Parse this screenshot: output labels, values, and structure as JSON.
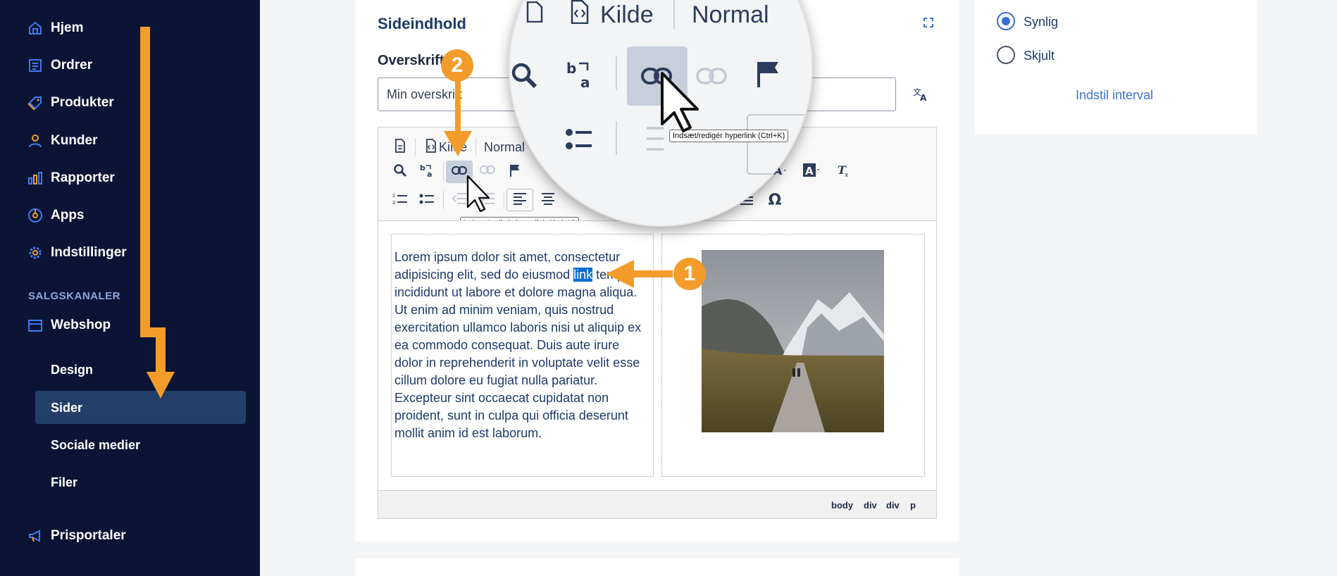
{
  "sidebar": {
    "items": [
      {
        "label": "Hjem",
        "icon": "home-icon"
      },
      {
        "label": "Ordrer",
        "icon": "orders-icon"
      },
      {
        "label": "Produkter",
        "icon": "tag-icon"
      },
      {
        "label": "Kunder",
        "icon": "user-icon"
      },
      {
        "label": "Rapporter",
        "icon": "bar-chart-icon"
      },
      {
        "label": "Apps",
        "icon": "apps-icon"
      },
      {
        "label": "Indstillinger",
        "icon": "gear-icon"
      }
    ],
    "section_label": "SALGSKANALER",
    "webshop_label": "Webshop",
    "sub_items": [
      "Design",
      "Sider",
      "Sociale medier",
      "Filer"
    ],
    "active_sub": "Sider",
    "prisportaler_label": "Prisportaler"
  },
  "content": {
    "title": "Sideindhold",
    "field_label": "Overskrift",
    "field_value": "Min overskrift"
  },
  "editor": {
    "source_label": "Kilde",
    "format_label": "Normal",
    "tooltip": "Indsæt/redigér hyperlink (Ctrl+K)",
    "text_before": " Lorem ipsum dolor sit amet, consectetur adipisicing elit, sed do eiusmod ",
    "text_selected": "link",
    "text_after": " tempor incididunt ut labore et dolore magna aliqua. Ut enim ad minim veniam, quis nostrud exercitation ullamco laboris nisi ut aliquip ex ea commodo consequat. Duis aute irure dolor in reprehenderit in voluptate velit esse cillum dolore eu fugiat nulla pariatur. Excepteur sint occaecat cupidatat non proident, sunt in culpa qui officia deserunt mollit anim id est laborum.",
    "path": [
      "body",
      "div",
      "div",
      "p"
    ]
  },
  "visibility": {
    "options": [
      "Synlig",
      "Skjult"
    ],
    "selected": "Synlig",
    "interval_link": "Indstil interval"
  },
  "annotations": {
    "badge_1": "1",
    "badge_2": "2"
  },
  "colors": {
    "sidebar_bg": "#0b1435",
    "accent_orange": "#f39c2b",
    "link_blue": "#3b74cd",
    "selection_blue": "#0b6ed1"
  }
}
